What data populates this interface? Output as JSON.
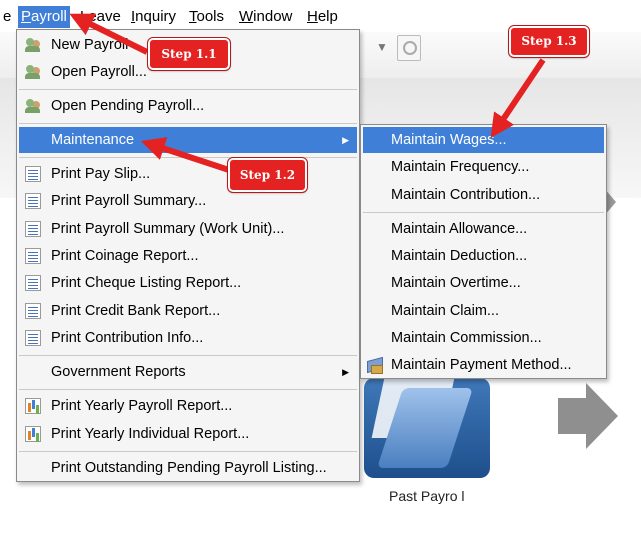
{
  "menubar": {
    "items": [
      {
        "label": "e"
      },
      {
        "label": "Payroll",
        "mnemonic": "P",
        "rest": "ayroll"
      },
      {
        "label": "Leave",
        "mnemonic": "L",
        "rest": "eave"
      },
      {
        "label": "Inquiry",
        "mnemonic": "I",
        "rest": "nquiry"
      },
      {
        "label": "Tools",
        "mnemonic": "T",
        "rest": "ools"
      },
      {
        "label": "Window",
        "mnemonic": "W",
        "rest": "indow"
      },
      {
        "label": "Help",
        "mnemonic": "H",
        "rest": "elp"
      }
    ]
  },
  "payroll_menu": {
    "items": [
      {
        "label": "New Payroll",
        "icon": "people-icon"
      },
      {
        "label": "Open Payroll...",
        "icon": "people-icon"
      },
      {
        "label": "Open Pending Payroll...",
        "icon": "people-icon"
      },
      {
        "label": "Maintenance",
        "highlighted": true,
        "submenu": true
      },
      {
        "label": "Print Pay Slip...",
        "icon": "document-icon"
      },
      {
        "label": "Print Payroll Summary...",
        "icon": "document-icon"
      },
      {
        "label": "Print Payroll Summary (Work Unit)...",
        "icon": "document-icon"
      },
      {
        "label": "Print Coinage Report...",
        "icon": "document-icon"
      },
      {
        "label": "Print Cheque Listing Report...",
        "icon": "document-icon"
      },
      {
        "label": "Print Credit Bank Report...",
        "icon": "document-icon"
      },
      {
        "label": "Print Contribution Info...",
        "icon": "document-icon"
      },
      {
        "label": "Government Reports",
        "submenu": true
      },
      {
        "label": "Print Yearly Payroll Report...",
        "icon": "bar-chart-icon"
      },
      {
        "label": "Print Yearly Individual Report...",
        "icon": "bar-chart-icon"
      },
      {
        "label": "Print Outstanding Pending Payroll Listing..."
      }
    ]
  },
  "maintenance_menu": {
    "items": [
      {
        "label": "Maintain Wages...",
        "highlighted": true
      },
      {
        "label": "Maintain Frequency..."
      },
      {
        "label": "Maintain Contribution..."
      },
      {
        "label": "Maintain Allowance..."
      },
      {
        "label": "Maintain Deduction..."
      },
      {
        "label": "Maintain Overtime..."
      },
      {
        "label": "Maintain Claim..."
      },
      {
        "label": "Maintain Commission..."
      },
      {
        "label": "Maintain Payment Method...",
        "icon": "payment-icon"
      }
    ]
  },
  "steps": {
    "step_1_1": "Step 1.1",
    "step_1_2": "Step 1.2",
    "step_1_3": "Step 1.3"
  },
  "background": {
    "past_payroll_label": "Past Payro l"
  },
  "colors": {
    "highlight": "#3f7fd7",
    "callout": "#e42222",
    "menu_bg": "#f5f5f5"
  }
}
